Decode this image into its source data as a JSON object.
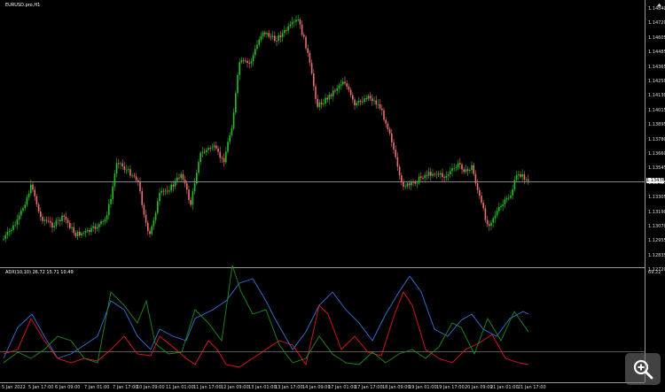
{
  "window": {
    "symbol_title": "EURUSD.pro,H1"
  },
  "price_axis": {
    "labels": [
      "1.14840",
      "1.14720",
      "1.14605",
      "1.14485",
      "1.14365",
      "1.14250",
      "1.14130",
      "1.14015",
      "1.13895",
      "1.13780",
      "1.13660",
      "1.13545",
      "1.13425",
      "1.13305",
      "1.13190",
      "1.13070",
      "1.12955",
      "1.12835",
      "1.12720"
    ],
    "current_price": "1.13436"
  },
  "indicator": {
    "title": "ADX(10,10) 26.72 15.71 10.49",
    "top_value": "69.22",
    "colors": {
      "adx": "#3a6fd8",
      "plus_di": "#1e8c1e",
      "minus_di": "#e01a1a"
    }
  },
  "time_axis": {
    "labels": [
      "5 Jan 2022",
      "5 Jan 17:00",
      "6 Jan 09:00",
      "7 Jan 01:00",
      "7 Jan 17:00",
      "10 Jan 09:00",
      "11 Jan 01:00",
      "11 Jan 17:00",
      "12 Jan 09:00",
      "13 Jan 01:00",
      "13 Jan 17:00",
      "14 Jan 09:00",
      "17 Jan 01:00",
      "17 Jan 17:00",
      "18 Jan 09:00",
      "19 Jan 01:00",
      "19 Jan 17:00",
      "20 Jan 09:00",
      "21 Jan 01:00",
      "21 Jan 17:00"
    ]
  },
  "colors": {
    "bull": "#22c022",
    "bear": "#e86f6f",
    "grid": "#9a9a9a"
  }
}
